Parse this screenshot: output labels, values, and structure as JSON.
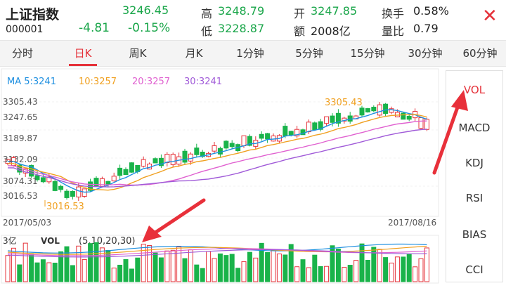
{
  "header": {
    "title": "上证指数",
    "code": "000001",
    "price": "3246.45",
    "change": "-4.81",
    "change_pct": "-0.15%",
    "high_label": "高",
    "high_value": "3248.79",
    "low_label": "低",
    "low_value": "3228.87",
    "open_label": "开",
    "open_value": "3247.85",
    "amount_label": "额",
    "amount_value": "2008亿",
    "turnover_label": "换手",
    "turnover_value": "0.58%",
    "volratio_label": "量比",
    "volratio_value": "0.79",
    "close_icon": "close-icon"
  },
  "tabs": [
    {
      "label": "分时"
    },
    {
      "label": "日K"
    },
    {
      "label": "周K"
    },
    {
      "label": "月K"
    },
    {
      "label": "1分钟"
    },
    {
      "label": "5分钟"
    },
    {
      "label": "15分钟"
    },
    {
      "label": "30分钟"
    },
    {
      "label": "60分钟"
    }
  ],
  "active_tab": "日K",
  "chart": {
    "ma_labels": [
      "MA 5:3241",
      "10:3257",
      "20:3257",
      "30:3241"
    ],
    "ma_colors": [
      "#1e8fe0",
      "#f0a020",
      "#e060d0",
      "#a05ad8"
    ],
    "y_ticks": [
      "3305.43",
      "3247.65",
      "3189.87",
      "3132.09",
      "3074.31",
      "3016.53"
    ],
    "max_label": "3305.43",
    "min_label": "3016.53",
    "date_start": "2017/05/03",
    "date_end": "2017/08/16",
    "vol_scale": "3亿",
    "vol_label": "VOL",
    "vol_params": "(5,10,20,30)",
    "up_color": "#e5323a",
    "down_color": "#19b34a"
  },
  "side_buttons": [
    "VOL",
    "MACD",
    "KDJ",
    "RSI",
    "BIAS",
    "CCI"
  ],
  "active_side": "VOL",
  "annotation_color": "#e8303a"
}
